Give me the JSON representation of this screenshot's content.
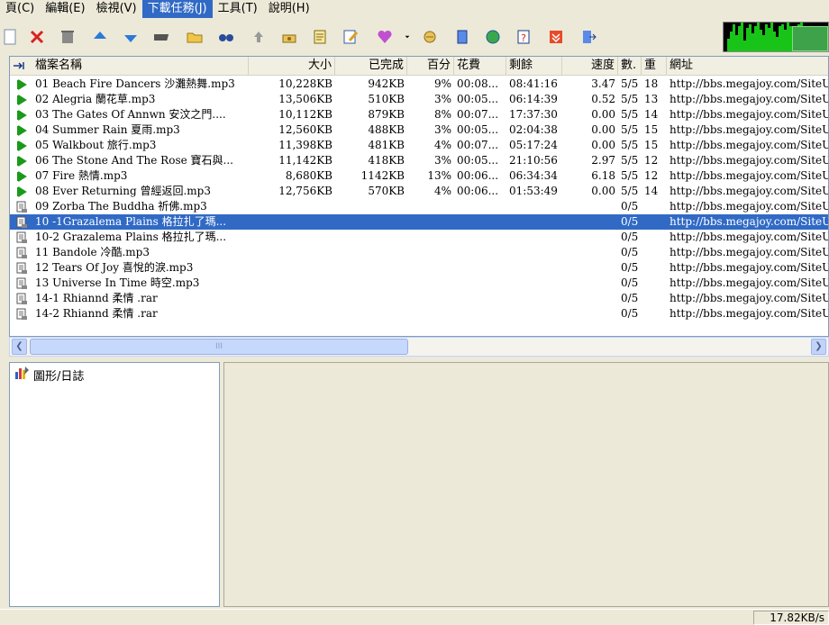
{
  "menu": [
    {
      "label": "頁(C)",
      "active": false
    },
    {
      "label": "編輯(E)",
      "active": false
    },
    {
      "label": "檢視(V)",
      "active": false
    },
    {
      "label": "下載任務(J)",
      "active": true
    },
    {
      "label": "工具(T)",
      "active": false
    },
    {
      "label": "說明(H)",
      "active": false
    }
  ],
  "toolbar_icons": [
    "new-task-icon",
    "delete-icon",
    "trash-icon",
    "move-up-icon",
    "move-down-icon",
    "tape-icon",
    "open-folder-icon",
    "find-icon",
    "upload-icon",
    "phone-icon",
    "properties-icon",
    "edit-icon",
    "heart-icon",
    "dropdown-arrow-icon",
    "connect-icon",
    "device-icon",
    "globe-icon",
    "help-icon",
    "download-red-icon",
    "exit-icon"
  ],
  "columns": [
    "檔案名稱",
    "大小",
    "已完成",
    "百分",
    "花費",
    "剩餘",
    "速度",
    "數.",
    "重",
    "網址"
  ],
  "tasks": [
    {
      "status": "running",
      "name": "01 Beach Fire Dancers 沙灘熱舞.mp3",
      "size": "10,228KB",
      "done": "942KB",
      "percent": "9%",
      "elapsed": "00:08...",
      "remaining": "08:41:16",
      "speed": "3.47",
      "conn": "5/5",
      "retry": "18",
      "url": "http://bbs.megajoy.com/SiteUp"
    },
    {
      "status": "running",
      "name": "02 Alegria 蘭花草.mp3",
      "size": "13,506KB",
      "done": "510KB",
      "percent": "3%",
      "elapsed": "00:05...",
      "remaining": "06:14:39",
      "speed": "0.52",
      "conn": "5/5",
      "retry": "13",
      "url": "http://bbs.megajoy.com/SiteUp"
    },
    {
      "status": "running",
      "name": "03 The Gates Of Annwn 安汶之門....",
      "size": "10,112KB",
      "done": "879KB",
      "percent": "8%",
      "elapsed": "00:07...",
      "remaining": "17:37:30",
      "speed": "0.00",
      "conn": "5/5",
      "retry": "14",
      "url": "http://bbs.megajoy.com/SiteUp"
    },
    {
      "status": "running",
      "name": "04 Summer Rain 夏雨.mp3",
      "size": "12,560KB",
      "done": "488KB",
      "percent": "3%",
      "elapsed": "00:05...",
      "remaining": "02:04:38",
      "speed": "0.00",
      "conn": "5/5",
      "retry": "15",
      "url": "http://bbs.megajoy.com/SiteUp"
    },
    {
      "status": "running",
      "name": "05 Walkbout 旅行.mp3",
      "size": "11,398KB",
      "done": "481KB",
      "percent": "4%",
      "elapsed": "00:07...",
      "remaining": "05:17:24",
      "speed": "0.00",
      "conn": "5/5",
      "retry": "15",
      "url": "http://bbs.megajoy.com/SiteUp"
    },
    {
      "status": "running",
      "name": "06 The Stone And The Rose 寶石與...",
      "size": "11,142KB",
      "done": "418KB",
      "percent": "3%",
      "elapsed": "00:05...",
      "remaining": "21:10:56",
      "speed": "2.97",
      "conn": "5/5",
      "retry": "12",
      "url": "http://bbs.megajoy.com/SiteUp"
    },
    {
      "status": "running",
      "name": "07 Fire 熱情.mp3",
      "size": "8,680KB",
      "done": "1142KB",
      "percent": "13%",
      "elapsed": "00:06...",
      "remaining": "06:34:34",
      "speed": "6.18",
      "conn": "5/5",
      "retry": "12",
      "url": "http://bbs.megajoy.com/SiteUp"
    },
    {
      "status": "running",
      "name": "08 Ever Returning 曾經返回.mp3",
      "size": "12,756KB",
      "done": "570KB",
      "percent": "4%",
      "elapsed": "00:06...",
      "remaining": "01:53:49",
      "speed": "0.00",
      "conn": "5/5",
      "retry": "14",
      "url": "http://bbs.megajoy.com/SiteUp"
    },
    {
      "status": "queued",
      "name": "09 Zorba The Buddha 祈佛.mp3",
      "size": "",
      "done": "",
      "percent": "",
      "elapsed": "",
      "remaining": "",
      "speed": "",
      "conn": "0/5",
      "retry": "",
      "url": "http://bbs.megajoy.com/SiteUp"
    },
    {
      "status": "queued",
      "name": "10 -1Grazalema Plains 格拉扎了瑪...",
      "size": "",
      "done": "",
      "percent": "",
      "elapsed": "",
      "remaining": "",
      "speed": "",
      "conn": "0/5",
      "retry": "",
      "url": "http://bbs.megajoy.com/SiteUp",
      "selected": true
    },
    {
      "status": "queued",
      "name": "10-2 Grazalema Plains 格拉扎了瑪...",
      "size": "",
      "done": "",
      "percent": "",
      "elapsed": "",
      "remaining": "",
      "speed": "",
      "conn": "0/5",
      "retry": "",
      "url": "http://bbs.megajoy.com/SiteUp"
    },
    {
      "status": "queued",
      "name": "11 Bandole 冷酷.mp3",
      "size": "",
      "done": "",
      "percent": "",
      "elapsed": "",
      "remaining": "",
      "speed": "",
      "conn": "0/5",
      "retry": "",
      "url": "http://bbs.megajoy.com/SiteUp"
    },
    {
      "status": "queued",
      "name": "12 Tears Of Joy 喜悅的淚.mp3",
      "size": "",
      "done": "",
      "percent": "",
      "elapsed": "",
      "remaining": "",
      "speed": "",
      "conn": "0/5",
      "retry": "",
      "url": "http://bbs.megajoy.com/SiteUp"
    },
    {
      "status": "queued",
      "name": "13 Universe In Time 時空.mp3",
      "size": "",
      "done": "",
      "percent": "",
      "elapsed": "",
      "remaining": "",
      "speed": "",
      "conn": "0/5",
      "retry": "",
      "url": "http://bbs.megajoy.com/SiteUp"
    },
    {
      "status": "queued",
      "name": "14-1 Rhiannd 柔情 .rar",
      "size": "",
      "done": "",
      "percent": "",
      "elapsed": "",
      "remaining": "",
      "speed": "",
      "conn": "0/5",
      "retry": "",
      "url": "http://bbs.megajoy.com/SiteUp"
    },
    {
      "status": "queued",
      "name": "14-2 Rhiannd 柔情 .rar",
      "size": "",
      "done": "",
      "percent": "",
      "elapsed": "",
      "remaining": "",
      "speed": "",
      "conn": "0/5",
      "retry": "",
      "url": "http://bbs.megajoy.com/SiteUp"
    }
  ],
  "tree": {
    "label": "圖形/日誌",
    "icon": "graph-log-icon"
  },
  "scroll_thumb_glyph": "III",
  "status": {
    "speed": "17.82KB/s"
  },
  "colors": {
    "selected": "#316ac5",
    "running_icon": "#1a9a1a",
    "meter": "#19c419"
  }
}
